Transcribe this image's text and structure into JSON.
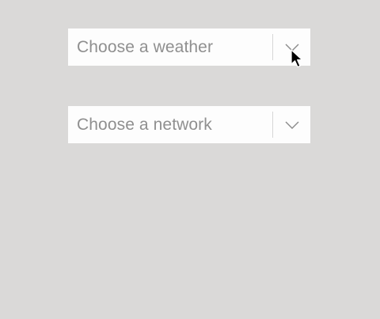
{
  "weather_select": {
    "placeholder": "Choose a weather",
    "icon": "chevron-down-icon"
  },
  "network_select": {
    "placeholder": "Choose a network",
    "icon": "chevron-down-icon"
  },
  "colors": {
    "background": "#dad9d8",
    "field": "#fdfdfd",
    "placeholder_text": "#8f8f8f",
    "chevron": "#8a8a8a"
  }
}
